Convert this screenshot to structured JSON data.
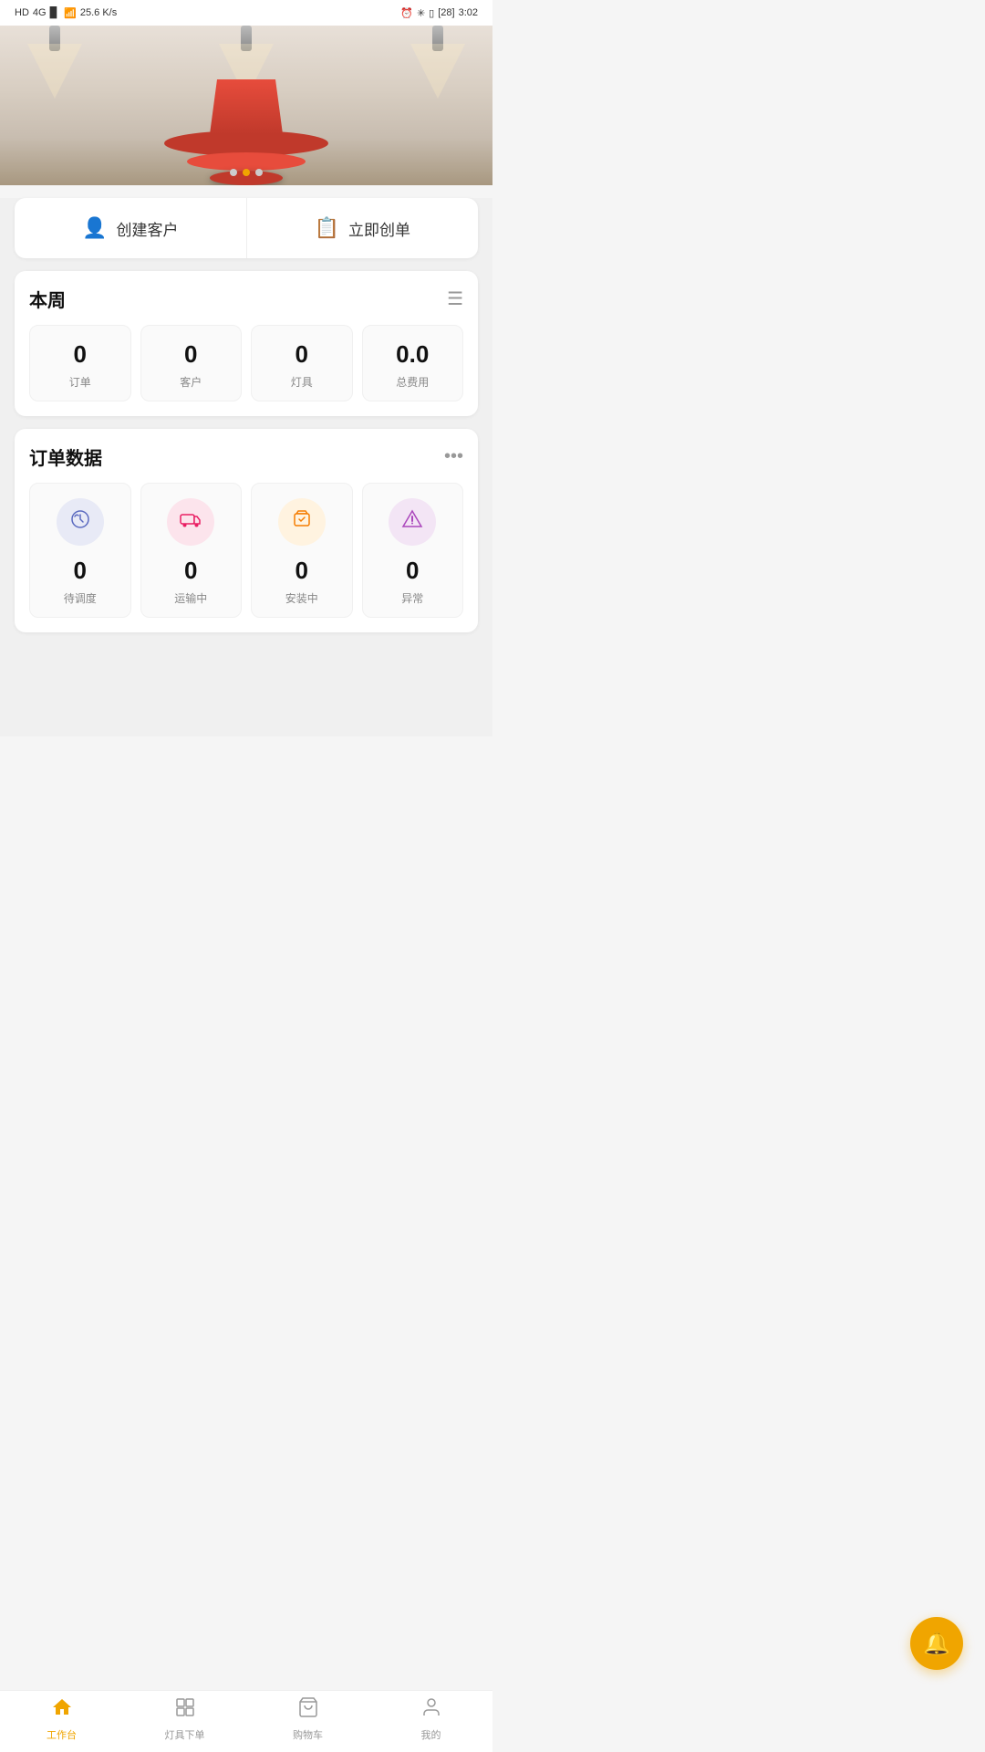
{
  "statusBar": {
    "left": "HD 4G 25.6 K/s",
    "right": "3:02"
  },
  "banner": {
    "dots": [
      {
        "active": false
      },
      {
        "active": true
      },
      {
        "active": false
      }
    ]
  },
  "quickActions": {
    "createCustomer": {
      "label": "创建客户",
      "icon": "👤"
    },
    "createOrder": {
      "label": "立即创单",
      "icon": "📋"
    }
  },
  "weeklySection": {
    "title": "本周",
    "stats": [
      {
        "number": "0",
        "label": "订单"
      },
      {
        "number": "0",
        "label": "客户"
      },
      {
        "number": "0",
        "label": "灯具"
      },
      {
        "number": "0.0",
        "label": "总费用"
      }
    ]
  },
  "orderSection": {
    "title": "订单数据",
    "items": [
      {
        "iconClass": "icon-blue",
        "icon": "📡",
        "number": "0",
        "label": "待调度"
      },
      {
        "iconClass": "icon-pink",
        "icon": "🚚",
        "number": "0",
        "label": "运输中"
      },
      {
        "iconClass": "icon-orange",
        "icon": "📦",
        "number": "0",
        "label": "安装中"
      },
      {
        "iconClass": "icon-purple",
        "icon": "⚠",
        "number": "0",
        "label": "异常"
      }
    ]
  },
  "bottomNav": [
    {
      "label": "工作台",
      "active": true
    },
    {
      "label": "灯具下单",
      "active": false
    },
    {
      "label": "购物车",
      "active": false
    },
    {
      "label": "我的",
      "active": false
    }
  ],
  "fab": {
    "icon": "🔔"
  }
}
